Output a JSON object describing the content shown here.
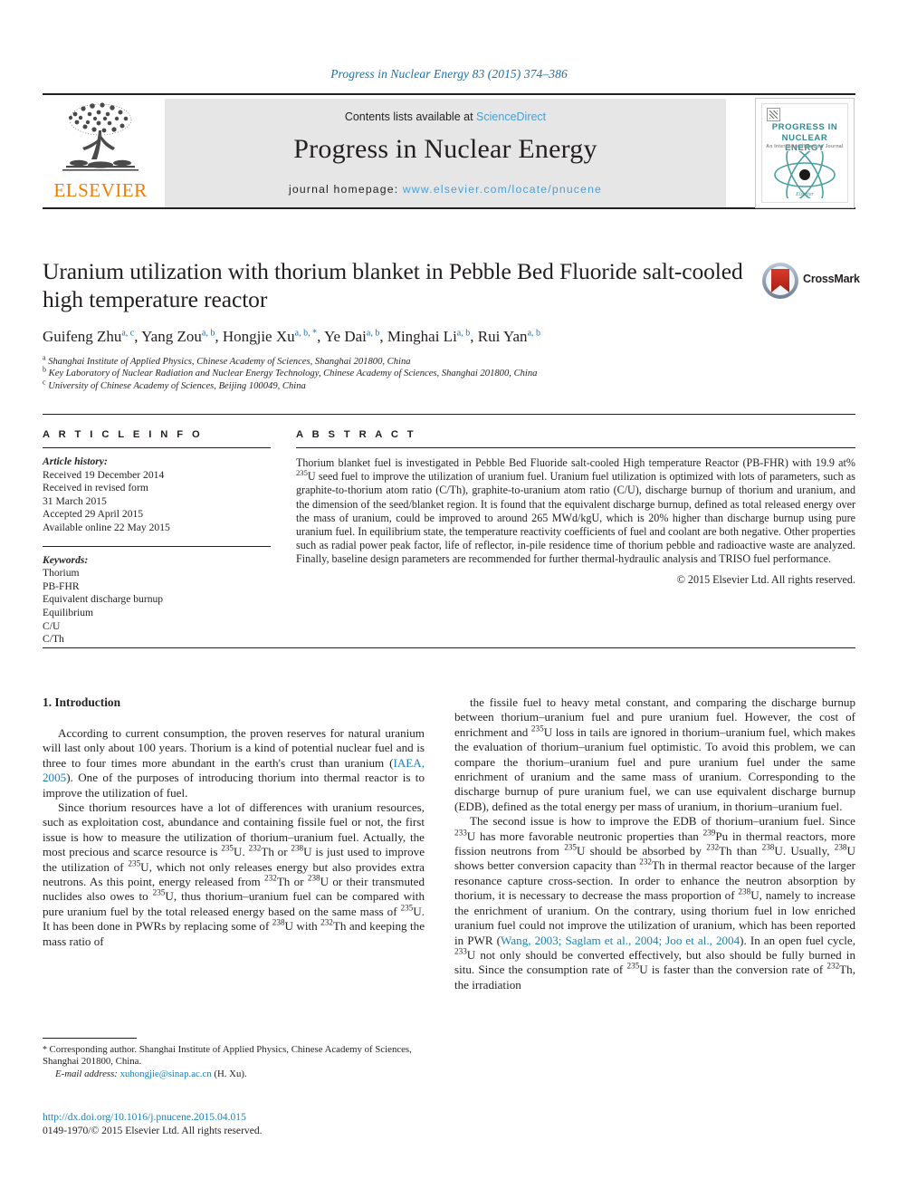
{
  "running_head": "Progress in Nuclear Energy 83 (2015) 374–386",
  "masthead": {
    "contents_prefix": "Contents lists available at",
    "sciencedirect": "ScienceDirect",
    "journal_title": "Progress in Nuclear Energy",
    "homepage_label": "journal homepage:",
    "homepage_url": "www.elsevier.com/locate/pnucene",
    "publisher_wordmark": "ELSEVIER",
    "publisher_logo_icon": "elsevier-tree-icon"
  },
  "cover": {
    "line1": "PROGRESS IN",
    "line2": "NUCLEAR ENERGY",
    "line3": "An International Review Journal",
    "atom_icon": "atom-icon",
    "footer": "Elsevier",
    "accent": "#2e8b91"
  },
  "article": {
    "title": "Uranium utilization with thorium blanket in Pebble Bed Fluoride salt-cooled high temperature reactor",
    "authors": [
      {
        "name": "Guifeng Zhu",
        "marks": "a, c",
        "sep": ", "
      },
      {
        "name": "Yang Zou",
        "marks": "a, b",
        "sep": ", "
      },
      {
        "name": "Hongjie Xu",
        "marks": "a, b, *",
        "sep": ", "
      },
      {
        "name": "Ye Dai",
        "marks": "a, b",
        "sep": ", "
      },
      {
        "name": "Minghai Li",
        "marks": "a, b",
        "sep": ", "
      },
      {
        "name": "Rui Yan",
        "marks": "a, b",
        "sep": ""
      }
    ],
    "affiliations": [
      {
        "mark": "a",
        "text": "Shanghai Institute of Applied Physics, Chinese Academy of Sciences, Shanghai 201800, China"
      },
      {
        "mark": "b",
        "text": "Key Laboratory of Nuclear Radiation and Nuclear Energy Technology, Chinese Academy of Sciences, Shanghai 201800, China"
      },
      {
        "mark": "c",
        "text": "University of Chinese Academy of Sciences, Beijing 100049, China"
      }
    ],
    "crossmark_label": "CrossMark",
    "crossmark_icon": "crossmark-icon"
  },
  "info": {
    "heading": "A R T I C L E   I N F O",
    "history_label": "Article history:",
    "history": [
      "Received 19 December 2014",
      "Received in revised form",
      "31 March 2015",
      "Accepted 29 April 2015",
      "Available online 22 May 2015"
    ],
    "keywords_label": "Keywords:",
    "keywords": [
      "Thorium",
      "PB-FHR",
      "Equivalent discharge burnup",
      "Equilibrium",
      "C/U",
      "C/Th"
    ]
  },
  "abstract": {
    "heading": "A B S T R A C T",
    "paragraph_parts": [
      {
        "t": "Thorium blanket fuel is investigated in Pebble Bed Fluoride salt-cooled High temperature Reactor (PB-FHR) with 19.9 at% "
      },
      {
        "sup": "235"
      },
      {
        "t": "U seed fuel to improve the utilization of uranium fuel. Uranium fuel utilization is optimized with lots of parameters, such as graphite-to-thorium atom ratio (C/Th), graphite-to-uranium atom ratio (C/U), discharge burnup of thorium and uranium, and the dimension of the seed/blanket region. It is found that the equivalent discharge burnup, defined as total released energy over the mass of uranium, could be improved to around 265 MWd/kgU, which is 20% higher than discharge burnup using pure uranium fuel. In equilibrium state, the temperature reactivity coefficients of fuel and coolant are both negative. Other properties such as radial power peak factor, life of reflector, in-pile residence time of thorium pebble and radioactive waste are analyzed. Finally, baseline design parameters are recommended for further thermal-hydraulic analysis and TRISO fuel performance."
      }
    ],
    "copyright": "© 2015 Elsevier Ltd. All rights reserved."
  },
  "body": {
    "section_number_title": "1. Introduction",
    "left_paragraphs": [
      [
        {
          "t": "According to current consumption, the proven reserves for natural uranium will last only about 100 years. Thorium is a kind of potential nuclear fuel and is three to four times more abundant in the earth's crust than uranium ("
        },
        {
          "link": "IAEA, 2005"
        },
        {
          "t": "). One of the purposes of introducing thorium into thermal reactor is to improve the utilization of fuel."
        }
      ],
      [
        {
          "t": "Since thorium resources have a lot of differences with uranium resources, such as exploitation cost, abundance and containing fissile fuel or not, the first issue is how to measure the utilization of thorium–uranium fuel. Actually, the most precious and scarce resource is "
        },
        {
          "sup": "235"
        },
        {
          "t": "U. "
        },
        {
          "sup": "232"
        },
        {
          "t": "Th or "
        },
        {
          "sup": "238"
        },
        {
          "t": "U is just used to improve the utilization of "
        },
        {
          "sup": "235"
        },
        {
          "t": "U, which not only releases energy but also provides extra neutrons. As this point, energy released from "
        },
        {
          "sup": "232"
        },
        {
          "t": "Th or "
        },
        {
          "sup": "238"
        },
        {
          "t": "U or their transmuted nuclides also owes to "
        },
        {
          "sup": "235"
        },
        {
          "t": "U, thus thorium–uranium fuel can be compared with pure uranium fuel by the total released energy based on the same mass of "
        },
        {
          "sup": "235"
        },
        {
          "t": "U. It has been done in PWRs by replacing some of "
        },
        {
          "sup": "238"
        },
        {
          "t": "U with "
        },
        {
          "sup": "232"
        },
        {
          "t": "Th and keeping the mass ratio of"
        }
      ]
    ],
    "right_paragraphs": [
      [
        {
          "t": "the fissile fuel to heavy metal constant, and comparing the discharge burnup between thorium–uranium fuel and pure uranium fuel. However, the cost of enrichment and "
        },
        {
          "sup": "235"
        },
        {
          "t": "U loss in tails are ignored in thorium–uranium fuel, which makes the evaluation of thorium–uranium fuel optimistic. To avoid this problem, we can compare the thorium–uranium fuel and pure uranium fuel under the same enrichment of uranium and the same mass of uranium. Corresponding to the discharge burnup of pure uranium fuel, we can use equivalent discharge burnup (EDB), defined as the total energy per mass of uranium, in thorium–uranium fuel."
        }
      ],
      [
        {
          "t": "The second issue is how to improve the EDB of thorium–uranium fuel. Since "
        },
        {
          "sup": "233"
        },
        {
          "t": "U has more favorable neutronic properties than "
        },
        {
          "sup": "239"
        },
        {
          "t": "Pu in thermal reactors, more fission neutrons from "
        },
        {
          "sup": "235"
        },
        {
          "t": "U should be absorbed by "
        },
        {
          "sup": "232"
        },
        {
          "t": "Th than "
        },
        {
          "sup": "238"
        },
        {
          "t": "U. Usually, "
        },
        {
          "sup": "238"
        },
        {
          "t": "U shows better conversion capacity than "
        },
        {
          "sup": "232"
        },
        {
          "t": "Th in thermal reactor because of the larger resonance capture cross-section. In order to enhance the neutron absorption by thorium, it is necessary to decrease the mass proportion of "
        },
        {
          "sup": "238"
        },
        {
          "t": "U, namely to increase the enrichment of uranium. On the contrary, using thorium fuel in low enriched uranium fuel could not improve the utilization of uranium, which has been reported in PWR ("
        },
        {
          "link": "Wang, 2003; Saglam et al., 2004; Joo et al., 2004"
        },
        {
          "t": "). In an open fuel cycle, "
        },
        {
          "sup": "233"
        },
        {
          "t": "U not only should be converted effectively, but also should be fully burned in situ. Since the consumption rate of "
        },
        {
          "sup": "235"
        },
        {
          "t": "U is faster than the conversion rate of "
        },
        {
          "sup": "232"
        },
        {
          "t": "Th, the irradiation"
        }
      ]
    ]
  },
  "footnote": {
    "star": "*",
    "corresponding": "Corresponding author. Shanghai Institute of Applied Physics, Chinese Academy of Sciences, Shanghai 201800, China.",
    "email_label": "E-mail address:",
    "email": "xuhongjie@sinap.ac.cn",
    "email_suffix": "(H. Xu)."
  },
  "doi": {
    "url": "http://dx.doi.org/10.1016/j.pnucene.2015.04.015",
    "issn_line": "0149-1970/© 2015 Elsevier Ltd. All rights reserved."
  }
}
